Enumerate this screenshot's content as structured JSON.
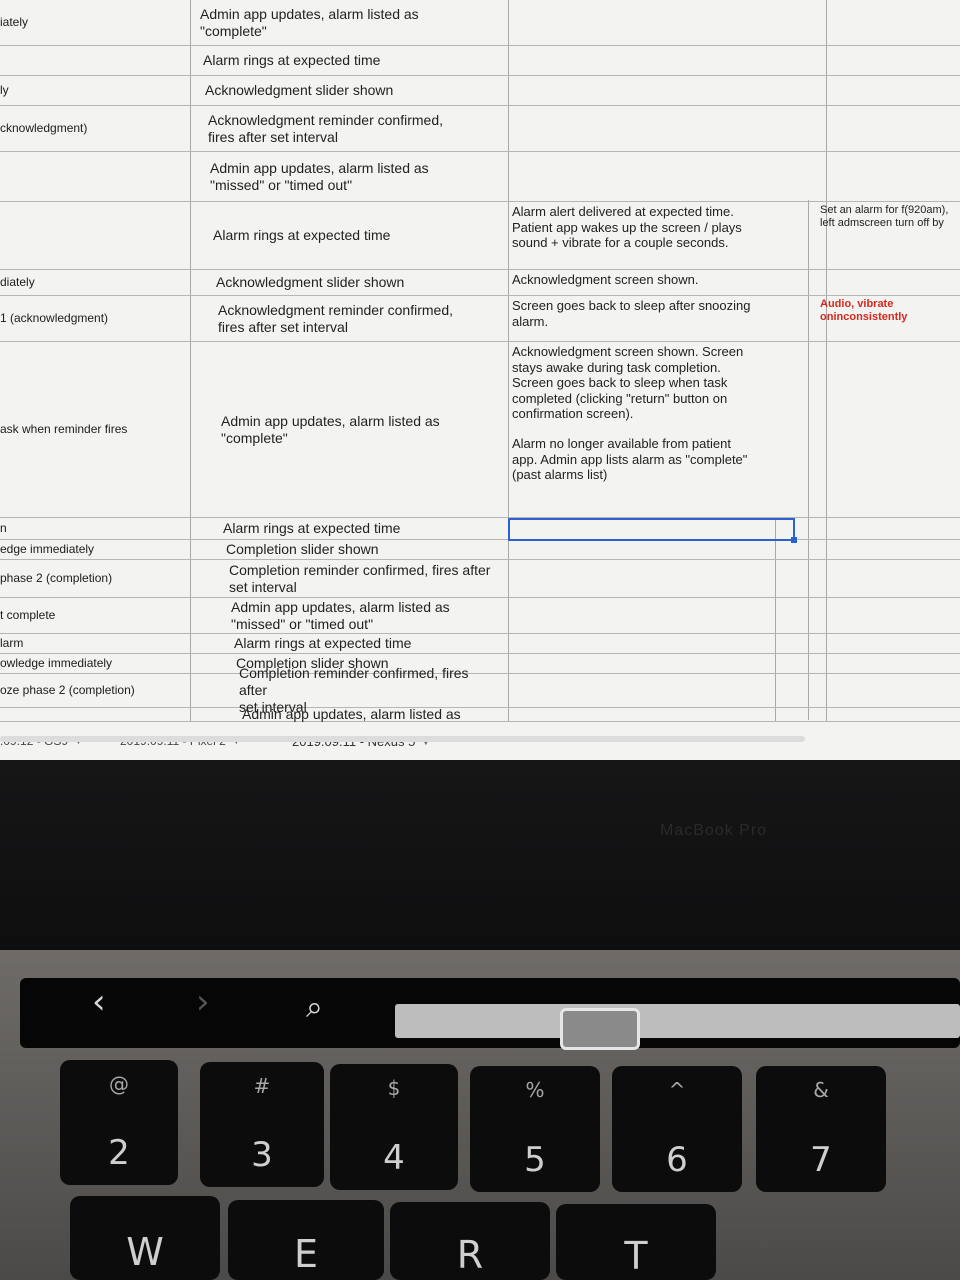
{
  "sheet": {
    "rows": [
      {
        "a": "iately",
        "b": [
          "Admin app updates, alarm listed as",
          "\"complete\""
        ],
        "c": [],
        "d": []
      },
      {
        "a": "",
        "b": [
          "Alarm rings at expected time"
        ],
        "c": [],
        "d": []
      },
      {
        "a": "ly",
        "b": [
          "Acknowledgment slider shown"
        ],
        "c": [],
        "d": []
      },
      {
        "a": "cknowledgment)",
        "b": [
          "Acknowledgment reminder confirmed,",
          "fires after set interval"
        ],
        "c": [],
        "d": []
      },
      {
        "a": "",
        "b": [
          "Admin app updates, alarm listed as",
          "\"missed\" or \"timed out\""
        ],
        "c": [],
        "d": []
      },
      {
        "a": "",
        "b": [
          "Alarm rings at expected time"
        ],
        "c": [
          "Alarm alert delivered at expected time.",
          "Patient app wakes up the screen / plays",
          "sound + vibrate for a couple seconds."
        ],
        "d": [
          "Set an alarm for f",
          "(920am), left adm",
          "screen turn off by"
        ]
      },
      {
        "a": "diately",
        "b": [
          "Acknowledgment slider shown"
        ],
        "c": [
          "Acknowledgment screen shown."
        ],
        "d": []
      },
      {
        "a": "1 (acknowledgment)",
        "b": [
          "Acknowledgment reminder confirmed,",
          "fires after set interval"
        ],
        "c": [
          "Screen goes back to sleep after snoozing",
          "alarm."
        ],
        "d_red": [
          "Audio, vibrate on",
          "inconsistently"
        ]
      },
      {
        "a": "ask when reminder fires",
        "b": [
          "Admin app updates, alarm listed as",
          "\"complete\""
        ],
        "c": [
          "Acknowledgment screen shown.  Screen",
          "stays awake during task completion.",
          "Screen goes back to sleep when task",
          "completed (clicking \"return\" button on",
          "confirmation screen).",
          "",
          "Alarm no longer available from patient",
          "app.  Admin app lists alarm as \"complete\"",
          "(past alarms list)"
        ],
        "d": []
      },
      {
        "a": "n",
        "b": [
          "Alarm rings at expected time"
        ],
        "c": [],
        "d": []
      },
      {
        "a": "edge immediately",
        "b": [
          "Completion slider shown"
        ],
        "c": [],
        "d": []
      },
      {
        "a": "phase 2 (completion)",
        "b": [
          "Completion reminder confirmed, fires after",
          "set interval"
        ],
        "c": [],
        "d": []
      },
      {
        "a": "t complete",
        "b": [
          "Admin app updates, alarm listed as",
          "\"missed\" or \"timed out\""
        ],
        "c": [],
        "d": []
      },
      {
        "a": "larm",
        "b": [
          "Alarm rings at expected time"
        ],
        "c": [],
        "d": []
      },
      {
        "a": "owledge immediately",
        "b": [
          "Completion slider shown"
        ],
        "c": [],
        "d": []
      },
      {
        "a": "oze phase 2 (completion)",
        "b": [
          "Completion reminder confirmed, fires after",
          "set interval"
        ],
        "c": [],
        "d": []
      },
      {
        "a": "",
        "b": [
          "Admin app updates, alarm listed as"
        ],
        "c": [],
        "d": []
      }
    ]
  },
  "tabs": [
    {
      "label": ".09.12 - GS9"
    },
    {
      "label": "2019.09.11 - Pixel 2"
    },
    {
      "label": "2019.09.11 - Nexus 5"
    }
  ],
  "laptop": {
    "brand": "MacBook Pro"
  },
  "touchbar": {
    "back_icon": "back-chevron-icon",
    "forward_icon": "forward-chevron-icon",
    "search_icon": "search-icon"
  },
  "keys": [
    {
      "top": "@",
      "bottom": "2"
    },
    {
      "top": "#",
      "bottom": "3"
    },
    {
      "top": "$",
      "bottom": "4"
    },
    {
      "top": "%",
      "bottom": "5"
    },
    {
      "top": "^",
      "bottom": "6"
    },
    {
      "top": "&",
      "bottom": "7"
    },
    {
      "top": "",
      "bottom": "W"
    },
    {
      "top": "",
      "bottom": "E"
    },
    {
      "top": "",
      "bottom": "R"
    },
    {
      "top": "",
      "bottom": "T"
    }
  ]
}
